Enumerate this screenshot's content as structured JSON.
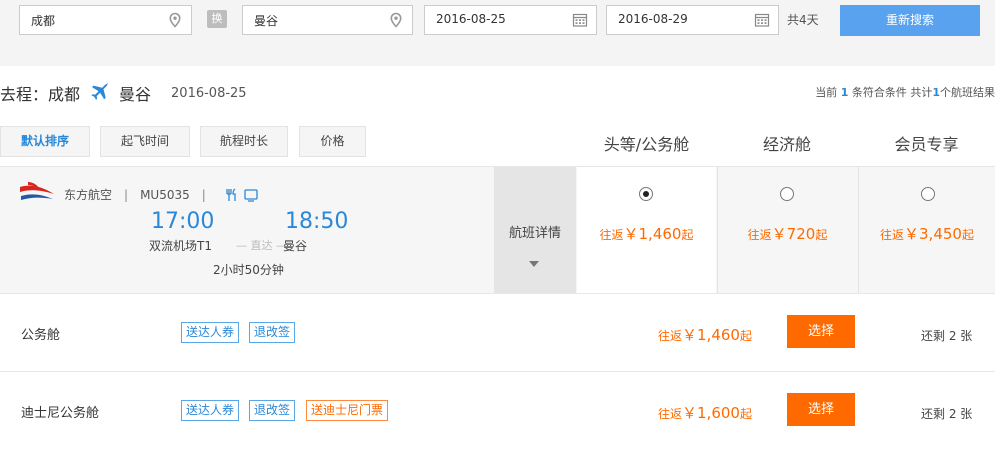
{
  "search": {
    "from": "成都",
    "swap_label": "换",
    "to": "曼谷",
    "depart_date": "2016-08-25",
    "return_date": "2016-08-29",
    "days": "共4天",
    "button": "重新搜索"
  },
  "trip": {
    "label": "去程：成都",
    "destination": "曼谷",
    "date": "2016-08-25"
  },
  "summary": {
    "prefix": "当前",
    "count": "1",
    "middle": "条符合条件 共计",
    "total": "1",
    "suffix": "个航班结果"
  },
  "sort_tabs": [
    "默认排序",
    "起飞时间",
    "航程时长",
    "价格"
  ],
  "cabin_classes": [
    "头等/公务舱",
    "经济舱",
    "会员专享"
  ],
  "flight": {
    "airline": "东方航空",
    "sep": "|",
    "flight_no": "MU5035",
    "dep_time": "17:00",
    "arr_time": "18:50",
    "dep_airport": "双流机场T1",
    "direct": "— 直达 —",
    "arr_airport": "曼谷",
    "duration": "2小时50分钟",
    "detail_label": "航班详情",
    "prices": [
      {
        "prefix": "往返",
        "amount": "￥1,460",
        "suffix": "起",
        "selected": true
      },
      {
        "prefix": "往返",
        "amount": "￥720",
        "suffix": "起",
        "selected": false
      },
      {
        "prefix": "往返",
        "amount": "￥3,450",
        "suffix": "起",
        "selected": false
      }
    ]
  },
  "cabins": [
    {
      "name": "公务舱",
      "tags": [
        "送达人券",
        "退改签"
      ],
      "price_prefix": "往返",
      "price": "￥1,460",
      "price_suffix": "起",
      "button": "选择",
      "remain": "还剩 2 张"
    },
    {
      "name": "迪士尼公务舱",
      "tags": [
        "送达人券",
        "退改签",
        "送迪士尼门票"
      ],
      "price_prefix": "往返",
      "price": "￥1,600",
      "price_suffix": "起",
      "button": "选择",
      "remain": "还剩 2 张"
    }
  ],
  "colors": {
    "accent_blue": "#2a88d8",
    "search_button": "#58a2f0",
    "price_orange": "#ff6a00"
  },
  "icons": [
    "location-pin-icon",
    "calendar-icon",
    "plane-icon",
    "meal-icon",
    "entertainment-icon",
    "airline-logo-icon",
    "chevron-down-icon"
  ]
}
